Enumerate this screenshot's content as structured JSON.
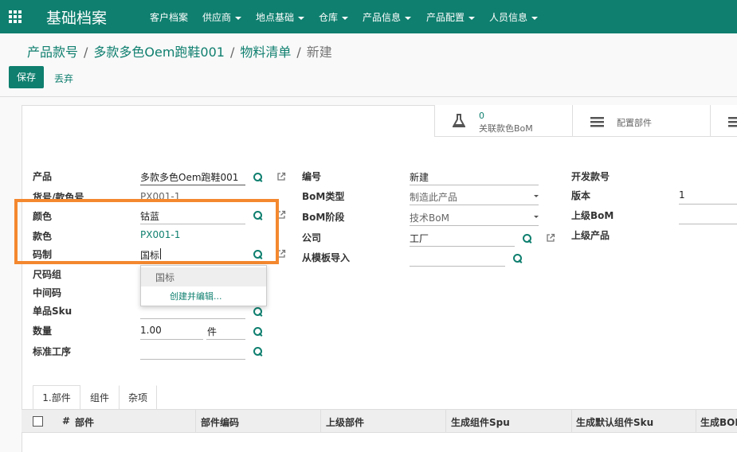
{
  "topbar": {
    "brand": "基础档案",
    "menu": [
      "客户档案",
      "供应商",
      "地点基础",
      "仓库",
      "产品信息",
      "产品配置",
      "人员信息"
    ]
  },
  "breadcrumb": {
    "items": [
      "产品款号",
      "多款多色Oem跑鞋001",
      "物料清单"
    ],
    "current": "新建"
  },
  "actions": {
    "save": "保存",
    "discard": "丢弃"
  },
  "stat_buttons": {
    "related_bom_count": "0",
    "related_bom_label": "关联款色BoM",
    "config_parts_label": "配置部件"
  },
  "left_fields": {
    "product_label": "产品",
    "product_value": "多款多色Oem跑鞋001",
    "article_label": "货号/款色号",
    "article_value": "PX001-1",
    "color_label": "颜色",
    "color_value": "钴蓝",
    "style_color_label": "款色",
    "style_color_value": "PX001-1",
    "size_system_label": "码制",
    "size_system_value": "国标",
    "size_group_label": "尺码组",
    "middle_code_label": "中间码",
    "sku_label": "单品Sku",
    "qty_label": "数量",
    "qty_value": "1.00",
    "uom_value": "件",
    "process_label": "标准工序"
  },
  "middle_fields": {
    "code_label": "编号",
    "code_value": "新建",
    "bom_type_label": "BoM类型",
    "bom_type_value": "制造此产品",
    "bom_stage_label": "BoM阶段",
    "bom_stage_value": "技术BoM",
    "company_label": "公司",
    "company_value": "工厂",
    "template_label": "从模板导入"
  },
  "right_fields": {
    "dev_no_label": "开发款号",
    "version_label": "版本",
    "version_value": "1",
    "parent_bom_label": "上级BoM",
    "parent_product_label": "上级产品"
  },
  "dropdown": {
    "option": "国标",
    "create_edit": "创建并编辑..."
  },
  "tabs": [
    "1.部件",
    "组件",
    "杂项"
  ],
  "table": {
    "headers": [
      "#",
      "部件",
      "部件编码",
      "上级部件",
      "生成组件Spu",
      "生成默认组件Sku",
      "生成BOM"
    ]
  },
  "colors": {
    "brand": "#0f7f6f",
    "highlight": "#f4882f"
  }
}
